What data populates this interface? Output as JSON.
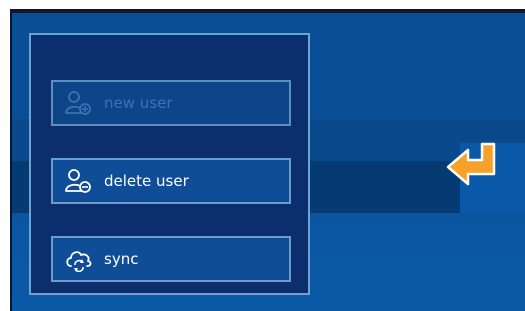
{
  "menu": {
    "items": [
      {
        "label": "new user",
        "icon": "add-user-icon",
        "enabled": false
      },
      {
        "label": "delete user",
        "icon": "remove-user-icon",
        "enabled": true
      },
      {
        "label": "sync",
        "icon": "cloud-sync-icon",
        "enabled": true
      }
    ]
  },
  "back_button": {
    "icon": "return-arrow-icon"
  },
  "colors": {
    "background": "#0a4f96",
    "panel": "#0c2e6c",
    "panel_border": "#6fa2cf",
    "button": "#0f4d96",
    "disabled_text": "#3d72b0",
    "accent": "#f7a12b"
  }
}
